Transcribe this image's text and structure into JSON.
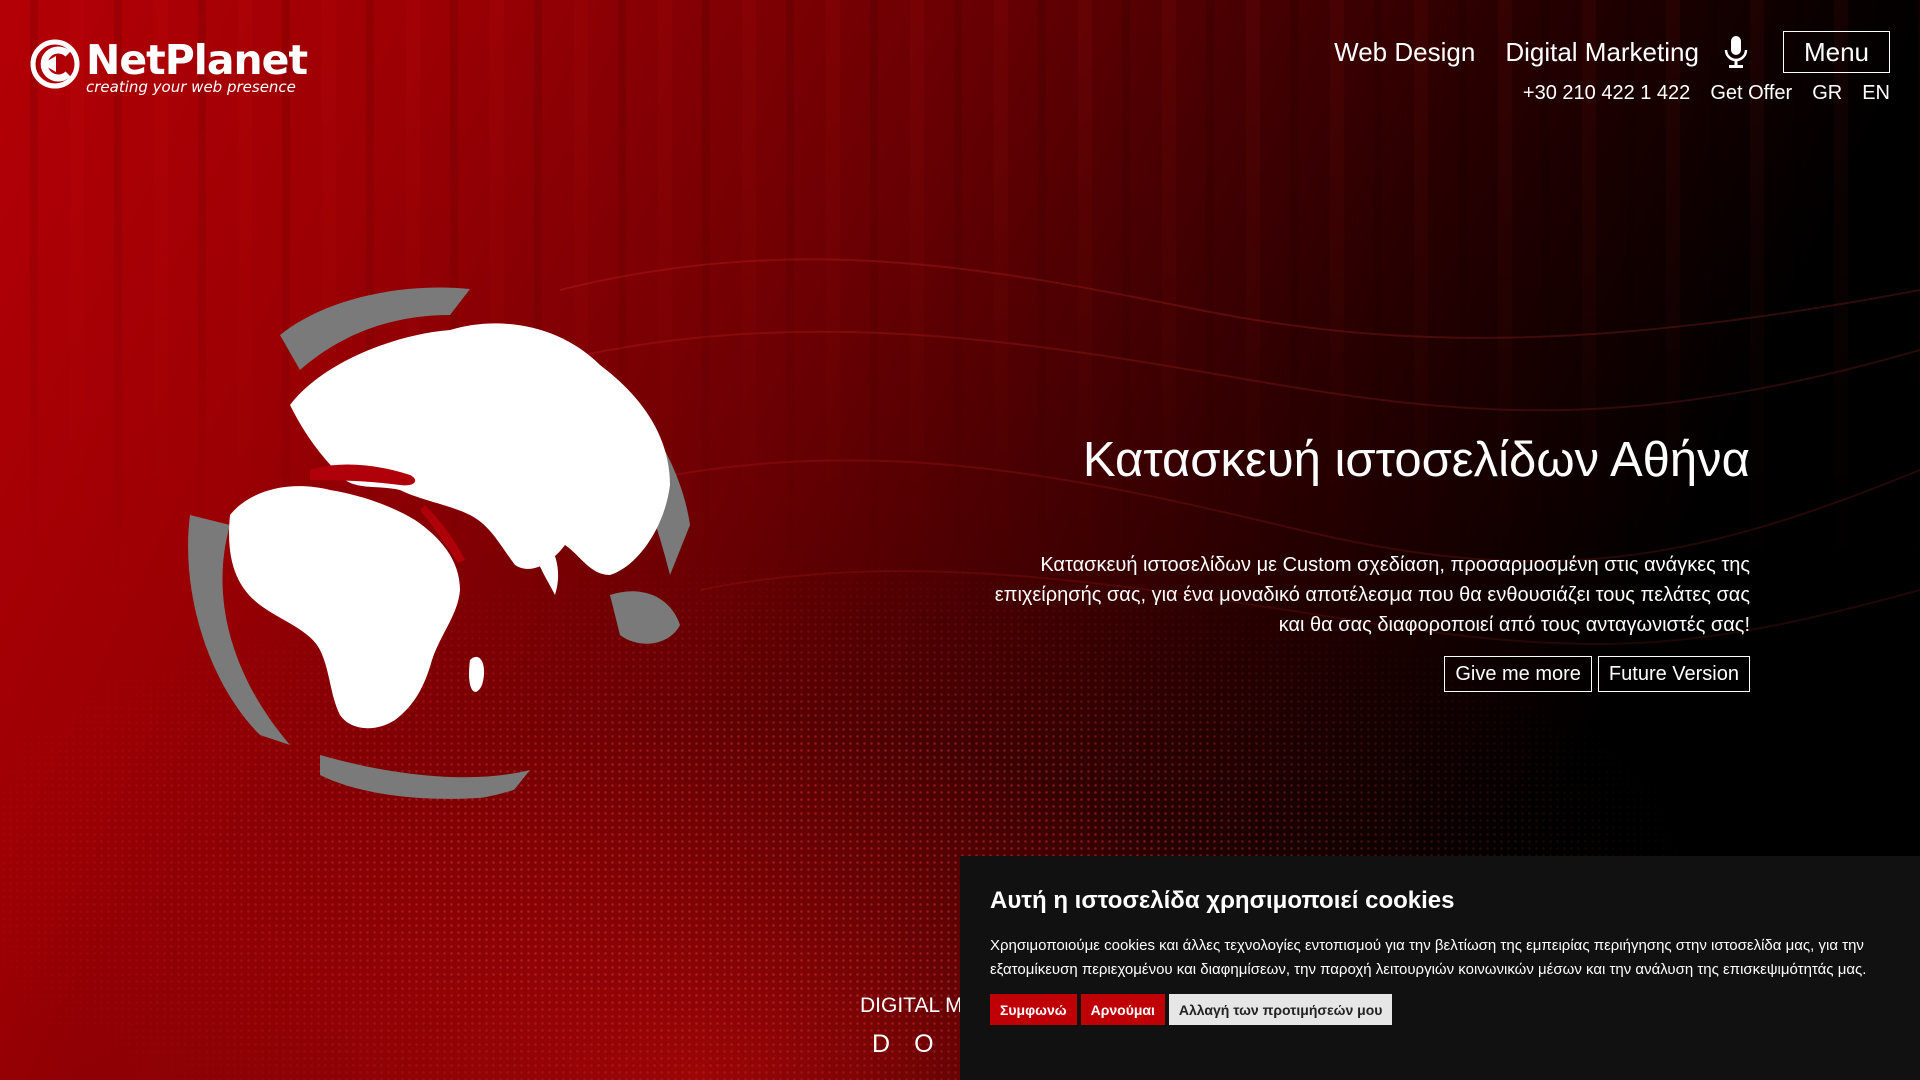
{
  "brand": {
    "name": "NetPlanet",
    "tagline": "creating your web presence"
  },
  "nav": {
    "items": [
      {
        "label": "Web Design"
      },
      {
        "label": "Digital Marketing"
      }
    ],
    "menu_label": "Menu",
    "mic_icon": "microphone-icon"
  },
  "subnav": {
    "phone": "+30 210 422 1 422",
    "offer": "Get Offer",
    "lang_gr": "GR",
    "lang_en": "EN"
  },
  "hero": {
    "title": "Κατασκευή ιστοσελίδων Αθήνα",
    "description": "Κατασκευή ιστοσελίδων με Custom σχεδίαση, προσαρμοσμένη στις ανάγκες της επιχείρησής σας, για ένα μοναδικό αποτέλεσμα που θα ενθουσιάζει τους πελάτες σας και θα σας διαφοροποιεί από τους ανταγωνιστές σας!",
    "buttons": [
      {
        "label": "Give me more"
      },
      {
        "label": "Future Version"
      }
    ]
  },
  "ticker": {
    "label": "DIGITAL M",
    "letters": [
      "D",
      "O"
    ]
  },
  "cookie": {
    "title": "Αυτή η ιστοσελίδα χρησιμοποιεί cookies",
    "text": "Χρησιμοποιούμε cookies και άλλες τεχνολογίες εντοπισμού για την βελτίωση της εμπειρίας περιήγησης στην ιστοσελίδα μας, για την εξατομίκευση περιεχομένου και διαφημίσεων, την παροχή λειτουργιών κοινωνικών μέσων και την ανάλυση της επισκεψιμότητάς μας.",
    "accept": "Συμφωνώ",
    "deny": "Αρνούμαι",
    "prefs": "Αλλαγή των προτιμήσεών μου"
  },
  "colors": {
    "brand_red": "#c00007",
    "banner_bg": "#111111",
    "prefs_bg": "#e6e6e6"
  }
}
